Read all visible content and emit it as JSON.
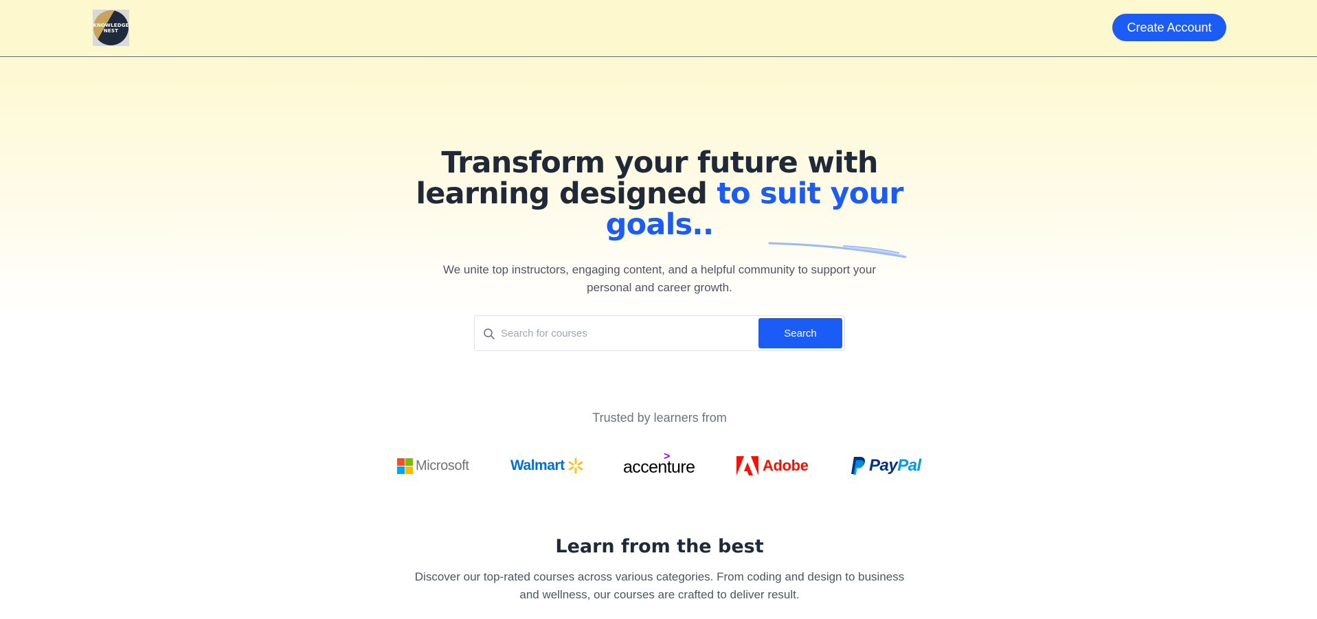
{
  "header": {
    "logo_text_line1": "KNOWLEDGE",
    "logo_text_line2": "NEST",
    "create_account_label": "Create Account"
  },
  "hero": {
    "title_part1": "Transform your future with learning designed ",
    "title_accent": "to suit your goals..",
    "subtitle": "We unite top instructors, engaging content, and a helpful community to support your personal and career growth."
  },
  "search": {
    "placeholder": "Search for courses",
    "button_label": "Search",
    "icon": "search-icon"
  },
  "trusted": {
    "label": "Trusted by learners from",
    "brands": [
      "Microsoft",
      "Walmart",
      "accenture",
      "Adobe",
      "PayPal"
    ],
    "paypal_pay": "Pay",
    "paypal_pal": "Pal"
  },
  "learn": {
    "title": "Learn from the best",
    "subtitle": "Discover our top-rated courses across various categories. From coding and design to business and wellness, our courses are crafted to deliver result."
  },
  "colors": {
    "accent": "#1a5cf5",
    "header_bg": "#fef8cf",
    "heading": "#1f2937",
    "body_text": "#4b5563"
  }
}
